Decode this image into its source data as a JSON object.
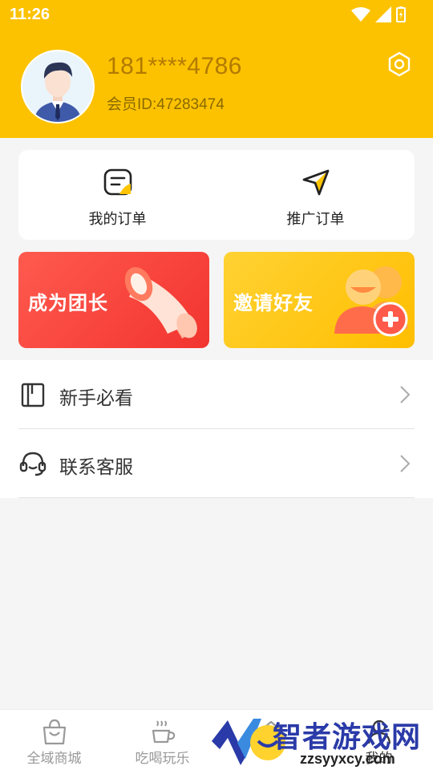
{
  "status_bar": {
    "time": "11:26"
  },
  "profile": {
    "phone": "181****4786",
    "member_id": "会员ID:47283474"
  },
  "orders": [
    {
      "label": "我的订单",
      "icon": "order-list-icon"
    },
    {
      "label": "推广订单",
      "icon": "paper-plane-icon"
    }
  ],
  "promos": [
    {
      "label": "成为团长",
      "color": "#f33a33",
      "icon": "megaphone-icon"
    },
    {
      "label": "邀请好友",
      "color": "#ffc400",
      "icon": "add-friends-icon"
    }
  ],
  "menu": [
    {
      "label": "新手必看",
      "icon": "book-icon"
    },
    {
      "label": "联系客服",
      "icon": "headset-icon"
    }
  ],
  "tabs": [
    {
      "label": "全域商城",
      "icon": "shopping-bag-icon"
    },
    {
      "label": "吃喝玩乐",
      "icon": "coffee-cup-icon"
    },
    {
      "label": "",
      "icon": "home-icon"
    },
    {
      "label": "我的",
      "icon": "user-icon"
    }
  ],
  "watermark": {
    "title": "智者游戏网",
    "url": "zzsyyxcy.com"
  },
  "colors": {
    "brand_yellow": "#fcc200",
    "promo_red": "#f33a33",
    "promo_yellow": "#ffc400",
    "watermark_blue": "#2a3aa8"
  }
}
